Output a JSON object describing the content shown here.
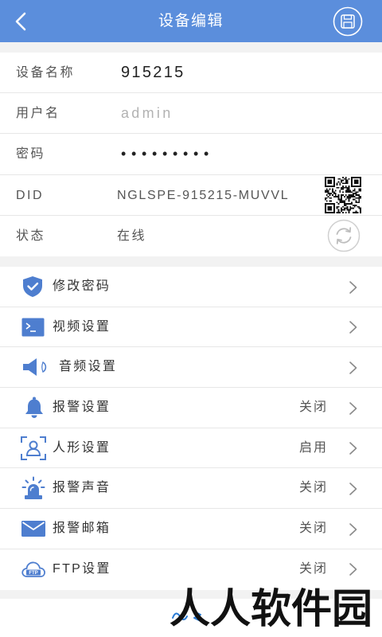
{
  "header": {
    "title": "设备编辑",
    "back_icon": "back-chevron-icon",
    "save_icon": "save-icon"
  },
  "colors": {
    "header_background": "#5b8edc",
    "icon_accent": "#4e7ecf",
    "page_background": "#f2f2f2"
  },
  "device": {
    "name": {
      "label": "设备名称",
      "value": "915215"
    },
    "username": {
      "label": "用户名",
      "value": "admin"
    },
    "password": {
      "label": "密码",
      "value": "•••••••••"
    },
    "did": {
      "label": "DID",
      "value": "NGLSPE-915215-MUVVL",
      "icon": "qr-code-icon"
    },
    "status": {
      "label": "状态",
      "value": "在线",
      "icon": "refresh-icon"
    }
  },
  "settings": [
    {
      "label": "修改密码",
      "icon": "shield-icon"
    },
    {
      "label": "视频设置",
      "icon": "terminal-icon"
    },
    {
      "label": "音频设置",
      "icon": "speaker-icon"
    },
    {
      "label": "报警设置",
      "status": "关闭",
      "icon": "bell-icon"
    },
    {
      "label": "人形设置",
      "status": "启用",
      "icon": "person-frame-icon"
    },
    {
      "label": "报警声音",
      "status": "关闭",
      "icon": "alarm-light-icon"
    },
    {
      "label": "报警邮箱",
      "status": "关闭",
      "icon": "envelope-icon"
    },
    {
      "label": "FTP设置",
      "status": "关闭",
      "icon": "ftp-cloud-icon",
      "icon_text": "FTP"
    }
  ],
  "watermark": {
    "text": "人人软件园"
  }
}
